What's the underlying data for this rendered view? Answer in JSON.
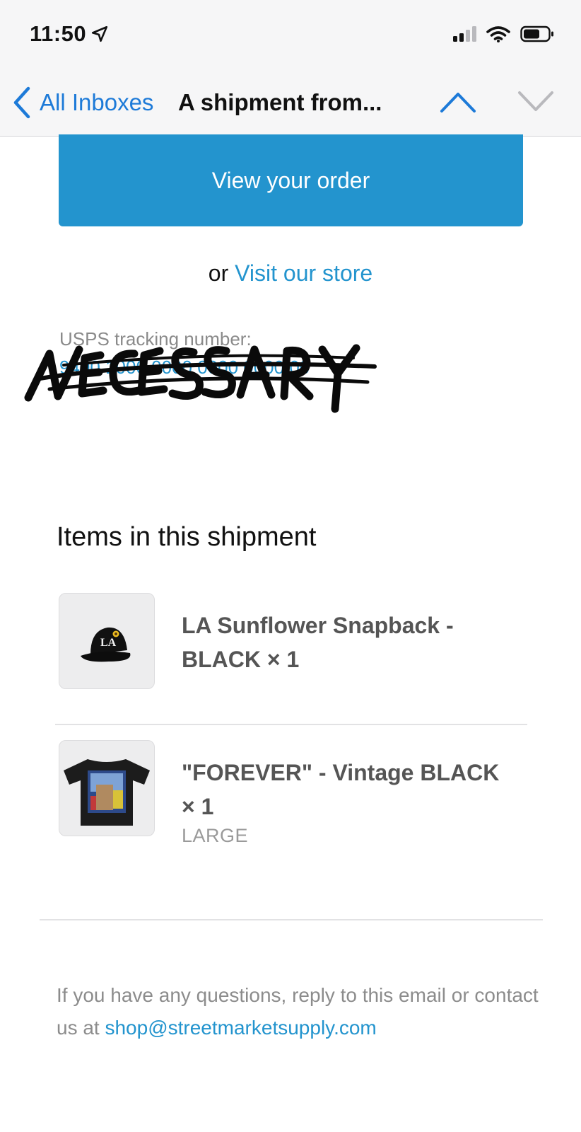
{
  "status_bar": {
    "time": "11:50",
    "icons": [
      "location-arrow-icon",
      "cellular-signal-icon",
      "wifi-icon",
      "battery-icon"
    ]
  },
  "nav": {
    "back_label": "All Inboxes",
    "title": "A shipment from...",
    "accent_color": "#1d7ad8"
  },
  "email": {
    "view_order_label": "View your order",
    "button_color": "#2394ce",
    "visit_prefix": "or",
    "visit_link": "Visit our store",
    "tracking_label": "USPS tracking number:",
    "tracking_number": "9400 1000 0000 0000 0000 00",
    "redaction_text": "NECESSARY",
    "items_heading": "Items in this shipment",
    "items": [
      {
        "title": "LA Sunflower Snapback - BLACK × 1",
        "variant": "",
        "thumb_icon": "snapback-cap-icon"
      },
      {
        "title": "\"FOREVER\" - Vintage BLACK × 1",
        "variant": "LARGE",
        "thumb_icon": "graphic-tshirt-icon"
      }
    ],
    "footer_text": "If you have any questions, reply to this email or contact us at ",
    "footer_email": "shop@streetmarketsupply.com"
  }
}
